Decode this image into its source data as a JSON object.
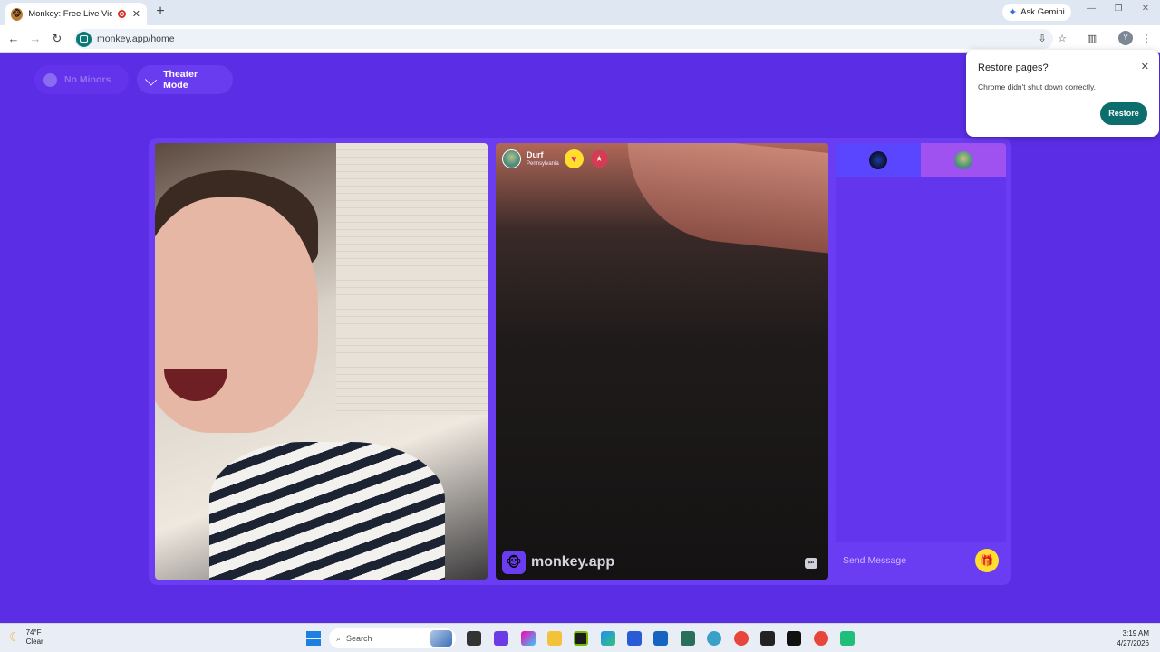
{
  "browser": {
    "tab_title": "Monkey: Free Live Video Ch",
    "new_tab_symbol": "+",
    "ask_gemini": "Ask Gemini",
    "url": "monkey.app/home",
    "profile_initial": "Y"
  },
  "page": {
    "no_minors_label": "No Minors",
    "theater_mode_label": "Theater Mode"
  },
  "peer": {
    "name": "Durf",
    "location": "Pennsylvania"
  },
  "brand": {
    "name": "monkey.app"
  },
  "chat": {
    "placeholder": "Send Message"
  },
  "restore_popup": {
    "title": "Restore pages?",
    "message": "Chrome didn't shut down correctly.",
    "button": "Restore"
  },
  "taskbar": {
    "temperature": "74°F",
    "condition": "Clear",
    "search_label": "Search",
    "time": "3:19 AM",
    "date": "4/27/2026"
  },
  "colors": {
    "page_bg": "#5b2ee6",
    "accent_yellow": "#ffde2e",
    "restore_teal": "#0b6e6c"
  }
}
